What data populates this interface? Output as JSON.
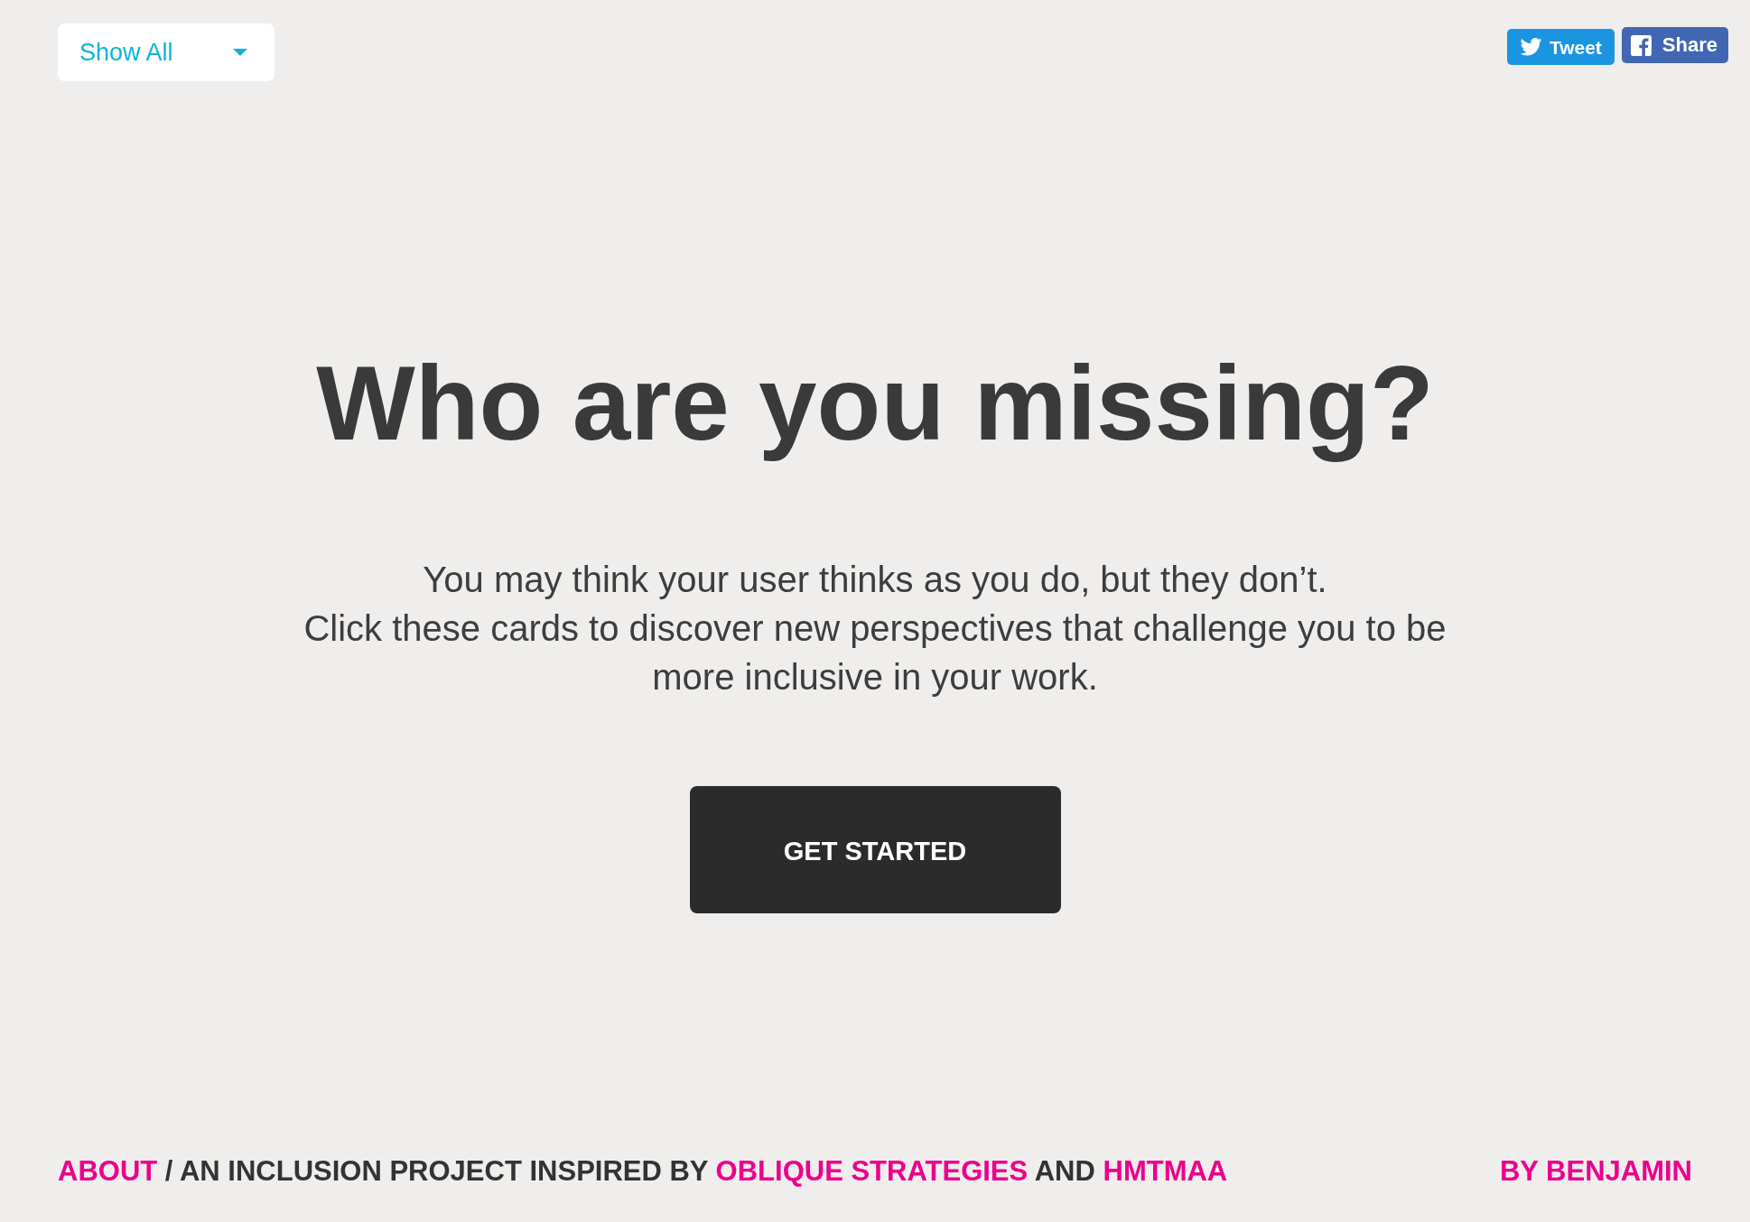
{
  "header": {
    "filter": {
      "value": "Show All"
    },
    "share_buttons": [
      {
        "kind": "twitter",
        "label": "Tweet"
      },
      {
        "kind": "facebook",
        "label": "Share"
      }
    ]
  },
  "hero": {
    "title": "Who are you missing?",
    "description_lines": [
      "You may think your user thinks as you do, but they don’t.",
      "Click these cards to discover new perspectives that challenge you to be more inclusive in your work."
    ],
    "cta": "GET STARTED"
  },
  "footer": {
    "credits": [
      {
        "kind": "link",
        "text": "ABOUT"
      },
      {
        "kind": "text",
        "text": "/ AN INCLUSION PROJECT INSPIRED BY"
      },
      {
        "kind": "link",
        "text": "OBLIQUE STRATEGIES"
      },
      {
        "kind": "text",
        "text": "AND"
      },
      {
        "kind": "link",
        "text": "HMTMAA"
      }
    ],
    "byline": "BY BENJAMIN"
  }
}
